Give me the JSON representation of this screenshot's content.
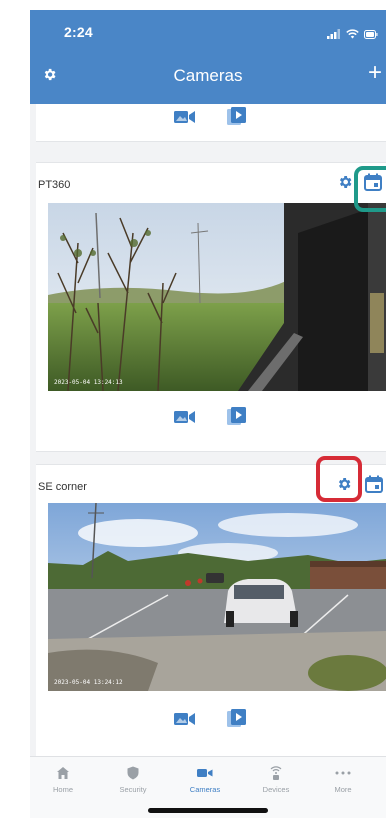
{
  "status_bar": {
    "time": "2:24"
  },
  "header": {
    "title": "Cameras",
    "add_label": "+"
  },
  "cameras": [
    {
      "name": "PT360",
      "timestamp": "2023-05-04 13:24:13"
    },
    {
      "name": "SE corner",
      "timestamp": "2023-05-04 13:24:12"
    }
  ],
  "tabs": [
    {
      "label": "Home",
      "icon": "home-icon"
    },
    {
      "label": "Security",
      "icon": "shield-icon"
    },
    {
      "label": "Cameras",
      "icon": "camera-icon",
      "active": true
    },
    {
      "label": "Devices",
      "icon": "wifi-icon"
    },
    {
      "label": "More",
      "icon": "more-icon"
    }
  ],
  "colors": {
    "header": "#4a86c7",
    "accent": "#3f7fc4",
    "highlight_teal": "#1f9a8a",
    "highlight_red": "#d62b36"
  }
}
